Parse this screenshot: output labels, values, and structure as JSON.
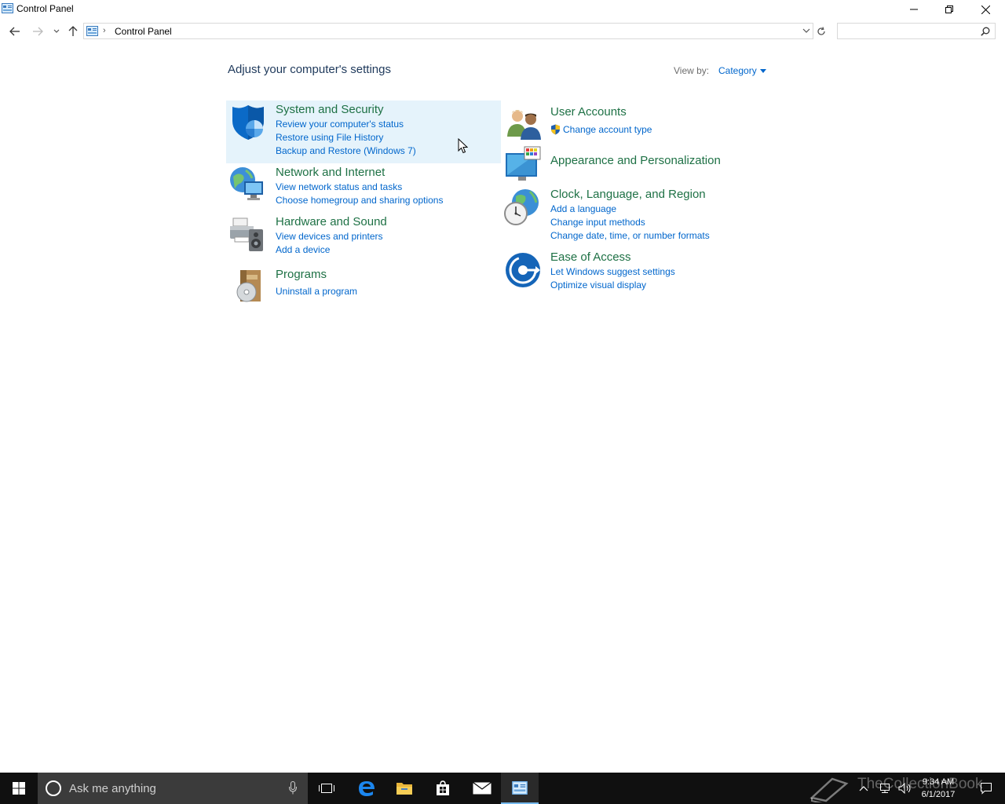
{
  "window": {
    "title": "Control Panel",
    "minimize_label": "Minimize",
    "restore_label": "Restore Down",
    "close_label": "Close"
  },
  "address": {
    "crumb": "Control Panel",
    "separator": "›",
    "search_placeholder": ""
  },
  "main": {
    "heading": "Adjust your computer's settings",
    "view_by_label": "View by:",
    "view_by_value": "Category",
    "categories": [
      {
        "title": "System and Security",
        "links": [
          "Review your computer's status",
          "Restore using File History",
          "Backup and Restore (Windows 7)"
        ]
      },
      {
        "title": "Network and Internet",
        "links": [
          "View network status and tasks",
          "Choose homegroup and sharing options"
        ]
      },
      {
        "title": "Hardware and Sound",
        "links": [
          "View devices and printers",
          "Add a device"
        ]
      },
      {
        "title": "Programs",
        "links": [
          "Uninstall a program"
        ]
      },
      {
        "title": "User Accounts",
        "links": [
          "Change account type"
        ]
      },
      {
        "title": "Appearance and Personalization",
        "links": []
      },
      {
        "title": "Clock, Language, and Region",
        "links": [
          "Add a language",
          "Change input methods",
          "Change date, time, or number formats"
        ]
      },
      {
        "title": "Ease of Access",
        "links": [
          "Let Windows suggest settings",
          "Optimize visual display"
        ]
      }
    ]
  },
  "taskbar": {
    "search_placeholder": "Ask me anything",
    "time": "9:34 AM",
    "date": "6/1/2017",
    "watermark": "TheCollectionBook"
  },
  "colors": {
    "link": "#0066cc",
    "category_title": "#1e7145",
    "heading": "#1e395b",
    "hover_bg": "#e5f3fb",
    "taskbar_bg": "#101010"
  }
}
